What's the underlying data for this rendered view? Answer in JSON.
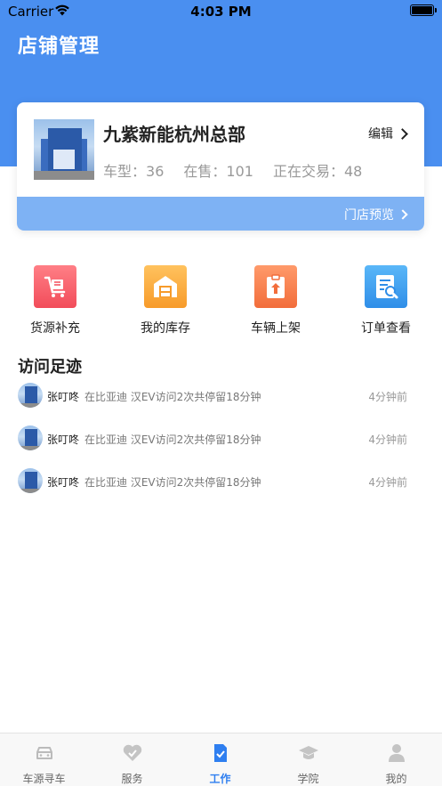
{
  "status_bar": {
    "carrier": "Carrier",
    "time": "4:03 PM"
  },
  "page_title": "店铺管理",
  "store": {
    "name": "九紫新能杭州总部",
    "edit_label": "编辑",
    "stats": {
      "models_label": "车型：",
      "models_value": "36",
      "on_sale_label": "在售：",
      "on_sale_value": "101",
      "trading_label": "正在交易：",
      "trading_value": "48"
    },
    "preview_label": "门店预览"
  },
  "quick_actions": [
    {
      "label": "货源补充",
      "icon": "cart-icon",
      "color": "#f24c5a"
    },
    {
      "label": "我的库存",
      "icon": "warehouse-icon",
      "color": "#f79b2a"
    },
    {
      "label": "车辆上架",
      "icon": "upload-clipboard-icon",
      "color": "#f26d3b"
    },
    {
      "label": "订单查看",
      "icon": "document-search-icon",
      "color": "#2f8ee8"
    }
  ],
  "visits": {
    "title": "访问足迹",
    "items": [
      {
        "name": "张叮咚",
        "desc": "在比亚迪 汉EV访问2次共停留18分钟",
        "time": "4分钟前"
      },
      {
        "name": "张叮咚",
        "desc": "在比亚迪 汉EV访问2次共停留18分钟",
        "time": "4分钟前"
      },
      {
        "name": "张叮咚",
        "desc": "在比亚迪 汉EV访问2次共停留18分钟",
        "time": "4分钟前"
      }
    ]
  },
  "tab_bar": {
    "items": [
      {
        "label": "车源寻车",
        "icon": "car-icon"
      },
      {
        "label": "服务",
        "icon": "service-icon"
      },
      {
        "label": "工作",
        "icon": "work-icon"
      },
      {
        "label": "学院",
        "icon": "graduation-cap-icon"
      },
      {
        "label": "我的",
        "icon": "profile-icon"
      }
    ],
    "active_index": 2
  },
  "colors": {
    "brand": "#4a8ff0",
    "active_tab": "#2f7ff0"
  }
}
